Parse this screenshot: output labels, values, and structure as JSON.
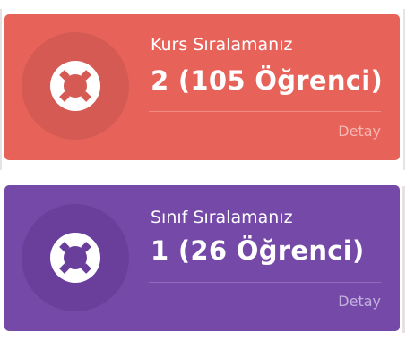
{
  "cards": [
    {
      "label": "Kurs Sıralamanız",
      "value": "2 (105 Öğrenci)",
      "detail_label": "Detay",
      "icon": "life-ring-icon",
      "colors": {
        "background": "#e7635a",
        "icon_circle": "#d45a53",
        "divider": "#f08b84",
        "detail_text": "#f6b7b2"
      }
    },
    {
      "label": "Sınıf Sıralamanız",
      "value": "1 (26 Öğrenci)",
      "detail_label": "Detay",
      "icon": "life-ring-icon",
      "colors": {
        "background": "#7449a8",
        "icon_circle": "#6a3f9c",
        "divider": "#8f6bbd",
        "detail_text": "#c4b1dd"
      }
    }
  ]
}
